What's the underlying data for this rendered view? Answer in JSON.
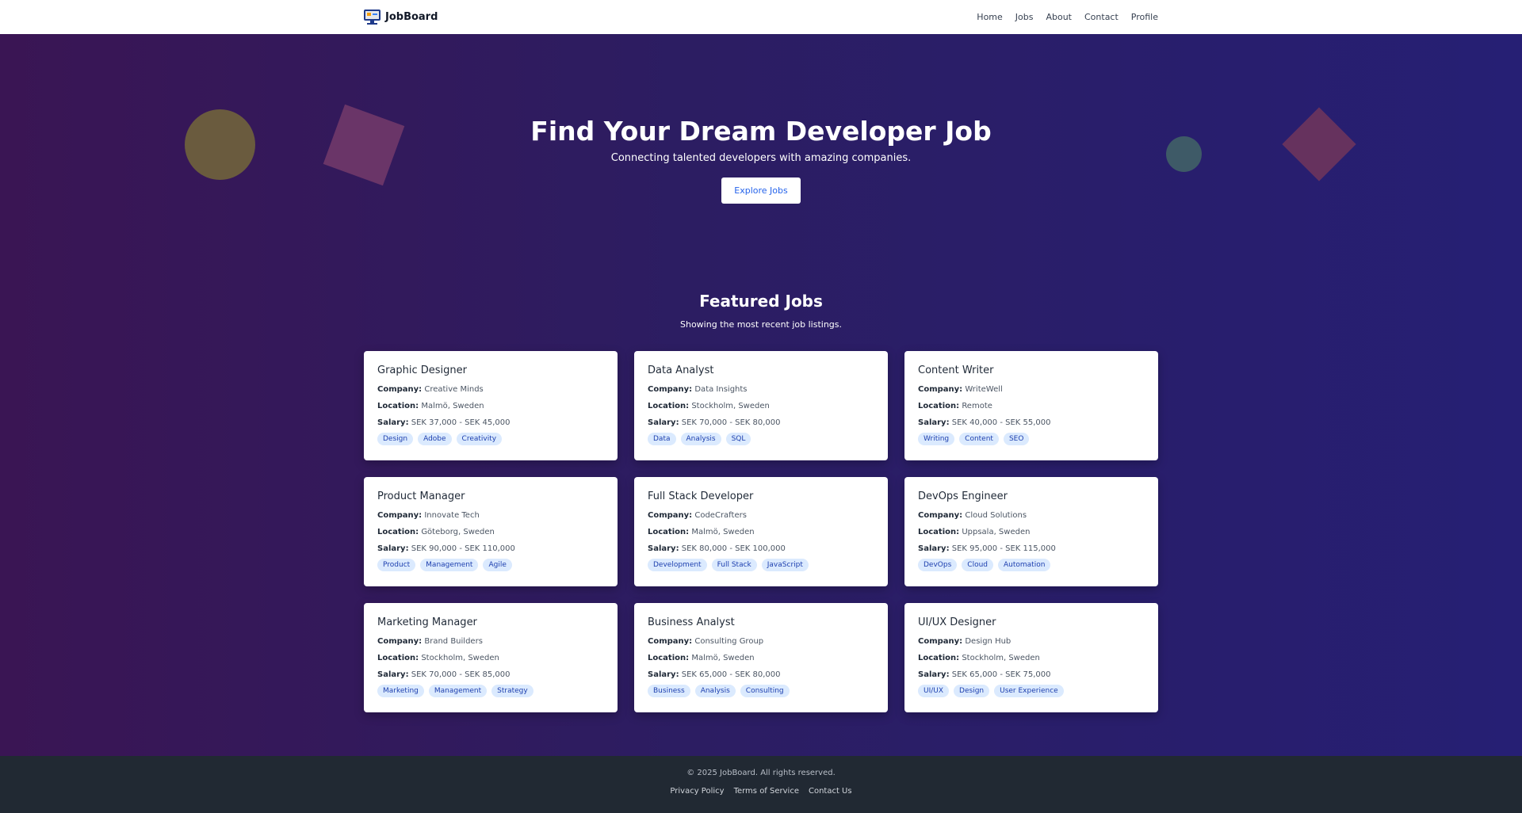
{
  "nav": {
    "brand": "JobBoard",
    "links": [
      "Home",
      "Jobs",
      "About",
      "Contact",
      "Profile"
    ]
  },
  "hero": {
    "title": "Find Your Dream Developer Job",
    "subtitle": "Connecting talented developers with amazing companies.",
    "button": "Explore Jobs"
  },
  "featured": {
    "title": "Featured Jobs",
    "subtitle": "Showing the most recent job listings."
  },
  "labels": {
    "company": "Company:",
    "location": "Location:",
    "salary": "Salary:"
  },
  "jobs": [
    {
      "title": "Graphic Designer",
      "company": "Creative Minds",
      "location": "Malmö, Sweden",
      "salary": "SEK 37,000 - SEK 45,000",
      "tags": [
        "Design",
        "Adobe",
        "Creativity"
      ]
    },
    {
      "title": "Data Analyst",
      "company": "Data Insights",
      "location": "Stockholm, Sweden",
      "salary": "SEK 70,000 - SEK 80,000",
      "tags": [
        "Data",
        "Analysis",
        "SQL"
      ]
    },
    {
      "title": "Content Writer",
      "company": "WriteWell",
      "location": "Remote",
      "salary": "SEK 40,000 - SEK 55,000",
      "tags": [
        "Writing",
        "Content",
        "SEO"
      ]
    },
    {
      "title": "Product Manager",
      "company": "Innovate Tech",
      "location": "Göteborg, Sweden",
      "salary": "SEK 90,000 - SEK 110,000",
      "tags": [
        "Product",
        "Management",
        "Agile"
      ]
    },
    {
      "title": "Full Stack Developer",
      "company": "CodeCrafters",
      "location": "Malmö, Sweden",
      "salary": "SEK 80,000 - SEK 100,000",
      "tags": [
        "Development",
        "Full Stack",
        "JavaScript"
      ]
    },
    {
      "title": "DevOps Engineer",
      "company": "Cloud Solutions",
      "location": "Uppsala, Sweden",
      "salary": "SEK 95,000 - SEK 115,000",
      "tags": [
        "DevOps",
        "Cloud",
        "Automation"
      ]
    },
    {
      "title": "Marketing Manager",
      "company": "Brand Builders",
      "location": "Stockholm, Sweden",
      "salary": "SEK 70,000 - SEK 85,000",
      "tags": [
        "Marketing",
        "Management",
        "Strategy"
      ]
    },
    {
      "title": "Business Analyst",
      "company": "Consulting Group",
      "location": "Malmö, Sweden",
      "salary": "SEK 65,000 - SEK 80,000",
      "tags": [
        "Business",
        "Analysis",
        "Consulting"
      ]
    },
    {
      "title": "UI/UX Designer",
      "company": "Design Hub",
      "location": "Stockholm, Sweden",
      "salary": "SEK 65,000 - SEK 75,000",
      "tags": [
        "UI/UX",
        "Design",
        "User Experience"
      ]
    }
  ],
  "footer": {
    "copyright": "© 2025 JobBoard. All rights reserved.",
    "links": [
      "Privacy Policy",
      "Terms of Service",
      "Contact Us"
    ]
  }
}
